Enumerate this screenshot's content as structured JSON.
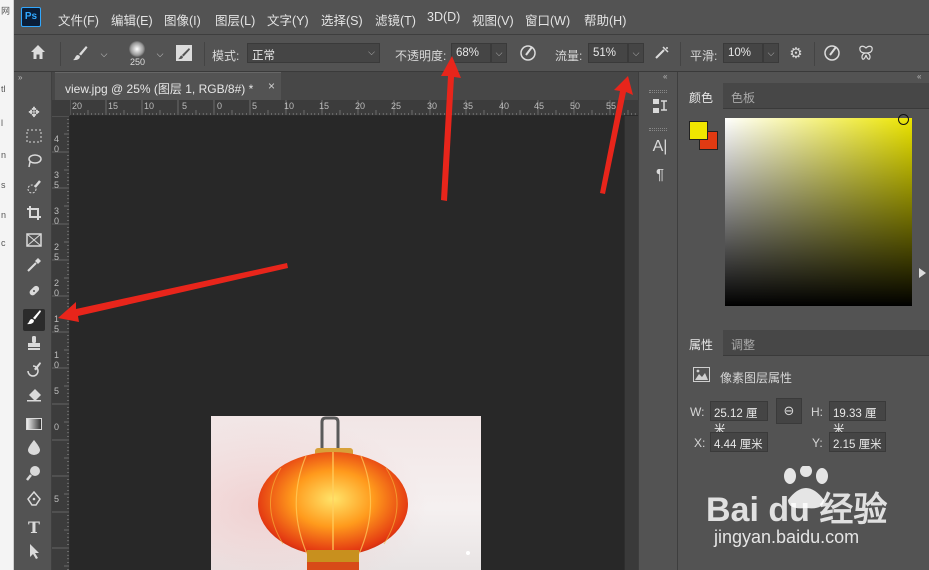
{
  "app": {
    "logo": "Ps"
  },
  "left_sliver": [
    "网",
    "tl",
    "l",
    "n",
    "s",
    "n",
    "c"
  ],
  "menu": [
    "文件(F)",
    "编辑(E)",
    "图像(I)",
    "图层(L)",
    "文字(Y)",
    "选择(S)",
    "滤镜(T)",
    "3D(D)",
    "视图(V)",
    "窗口(W)",
    "帮助(H)"
  ],
  "options": {
    "brush_size": "250",
    "mode_label": "模式:",
    "mode_value": "正常",
    "opacity_label": "不透明度:",
    "opacity_value": "68%",
    "flow_label": "流量:",
    "flow_value": "51%",
    "smoothing_label": "平滑:",
    "smoothing_value": "10%"
  },
  "document": {
    "tab_title": "view.jpg @ 25% (图层 1, RGB/8#) *",
    "close": "×"
  },
  "ruler_top": [
    "20",
    "15",
    "10",
    "5",
    "0",
    "5",
    "10",
    "15",
    "20",
    "25",
    "30",
    "35",
    "40",
    "45",
    "50",
    "55"
  ],
  "ruler_left": [
    "4",
    "0",
    "3",
    "5",
    "3",
    "0",
    "2",
    "5",
    "2",
    "0",
    "1",
    "5",
    "1",
    "0",
    "5",
    "0",
    "5"
  ],
  "color_panel": {
    "tabs": [
      "颜色",
      "色板"
    ],
    "foreground": "#f0e600",
    "background": "#e13a12"
  },
  "properties_panel": {
    "tabs": [
      "属性",
      "调整"
    ],
    "section_title": "像素图层属性",
    "w_label": "W:",
    "w_value": "25.12 厘米",
    "h_label": "H:",
    "h_value": "19.33 厘米",
    "x_label": "X:",
    "x_value": "4.44 厘米",
    "y_label": "Y:",
    "y_value": "2.15 厘米"
  },
  "watermark": {
    "brand": "Bai du 经验",
    "url": "jingyan.baidu.com"
  },
  "colors": {
    "ui_bg": "#535353",
    "canvas_bg": "#282828",
    "annotation_arrow": "#e8251b",
    "ps_blue": "#31a8ff"
  }
}
